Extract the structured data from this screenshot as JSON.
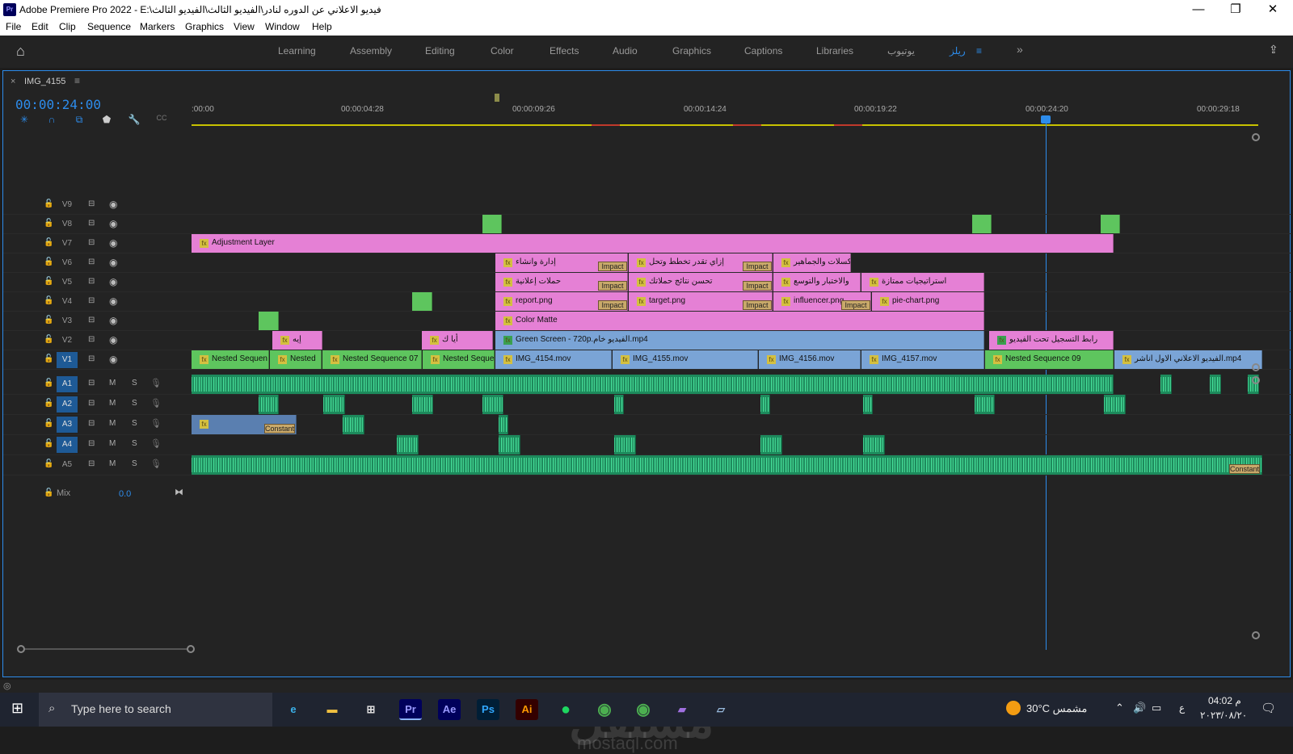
{
  "window": {
    "title": "Adobe Premiere Pro 2022 - E:\\فيديو الاعلاني عن الدوره لنادر\\الفيديو الثالث\\الفيديو الثالث",
    "app_icon": "Pr",
    "minimize": "—",
    "maximize": "❐",
    "close": "✕"
  },
  "menu": [
    "File",
    "Edit",
    "Clip",
    "Sequence",
    "Markers",
    "Graphics",
    "View",
    "Window",
    "Help"
  ],
  "workspaces": [
    "Learning",
    "Assembly",
    "Editing",
    "Color",
    "Effects",
    "Audio",
    "Graphics",
    "Captions",
    "Libraries",
    "يوتيوب",
    "ريلز"
  ],
  "workspace_active": "ريلز",
  "timeline": {
    "sequence_name": "IMG_4155",
    "timecode": "00:00:24:00",
    "ruler_ticks": [
      ":00:00",
      "00:00:04:28",
      "00:00:09:26",
      "00:00:14:24",
      "00:00:19:22",
      "00:00:24:20",
      "00:00:29:18"
    ]
  },
  "video_tracks": [
    "V9",
    "V8",
    "V7",
    "V6",
    "V5",
    "V4",
    "V3",
    "V2",
    "V1"
  ],
  "audio_tracks": [
    "A1",
    "A2",
    "A3",
    "A4",
    "A5"
  ],
  "audio_buttons": {
    "mute": "M",
    "solo": "S"
  },
  "mix": {
    "label": "Mix",
    "value": "0.0"
  },
  "clips": {
    "adjustment": "Adjustment Layer",
    "v6a": "إدارة وانشاء",
    "v6b": "إزاي تقدر تخطط وتحل",
    "v6c": "البكسلات والجماهير",
    "v5a": "حملات إعلانية",
    "v5b": "تحسن نتائج حملاتك",
    "v5c": "والاختبار والتوسع",
    "v5d": "استراتيجيات ممتازة",
    "v4a": "report.png",
    "v4b": "target.png",
    "v4c": "influencer.png",
    "v4d": "pie-chart.png",
    "v3": "Color Matte",
    "v2a": "إيه",
    "v2b": "أيا ك",
    "v2c": "Green Screen - 720p.الفيديو خام.mp4",
    "v2d": "رابط التسجيل تحت الفيديو",
    "v1a": "Nested Sequen",
    "v1b": "Nested",
    "v1c": "Nested Sequence 07",
    "v1d": "Nested Seque",
    "v1e": "IMG_4154.mov",
    "v1f": "IMG_4155.mov",
    "v1g": "IMG_4156.mov",
    "v1h": "IMG_4157.mov",
    "v1i": "Nested Sequence 09",
    "v1j": "الفيديو الاعلاني الاول اناشر.mp4",
    "impact": "Impact",
    "constant": "Constant"
  },
  "taskbar": {
    "search_placeholder": "Type here to search",
    "weather": "30°C  مشمس",
    "time": "04:02 م",
    "date": "٢٠٢٣/٠٨/٢٠",
    "lang": "ع"
  },
  "watermark": {
    "ar": "مستقل",
    "en": "mostaql.com"
  }
}
